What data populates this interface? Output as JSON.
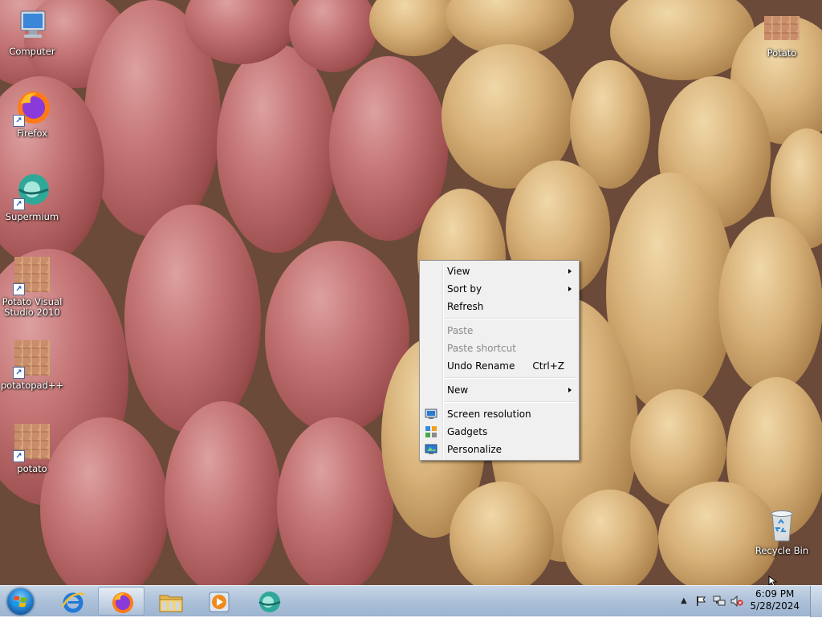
{
  "desktop_icons": {
    "computer": "Computer",
    "firefox": "Firefox",
    "supermium": "Supermium",
    "potato_vs": "Potato Visual Studio 2010",
    "potatopad": "potatopad++",
    "potato_short": "potato",
    "potato_folder": "Potato",
    "recycle_bin": "Recycle Bin"
  },
  "context_menu": {
    "view": "View",
    "sort_by": "Sort by",
    "refresh": "Refresh",
    "paste": "Paste",
    "paste_shortcut": "Paste shortcut",
    "undo_rename": "Undo Rename",
    "undo_shortcut": "Ctrl+Z",
    "new": "New",
    "screen_resolution": "Screen resolution",
    "gadgets": "Gadgets",
    "personalize": "Personalize"
  },
  "taskbar": {
    "time": "6:09 PM",
    "date": "5/28/2024"
  },
  "icons": {
    "start": "windows-start-orb",
    "ie": "internet-explorer-icon",
    "firefox": "firefox-icon",
    "explorer": "file-explorer-icon",
    "media": "media-player-icon",
    "supermium": "supermium-icon",
    "tray_up": "show-hidden-icons-chevron",
    "flag": "action-center-flag-icon",
    "network": "network-icon",
    "volume": "volume-muted-icon"
  }
}
